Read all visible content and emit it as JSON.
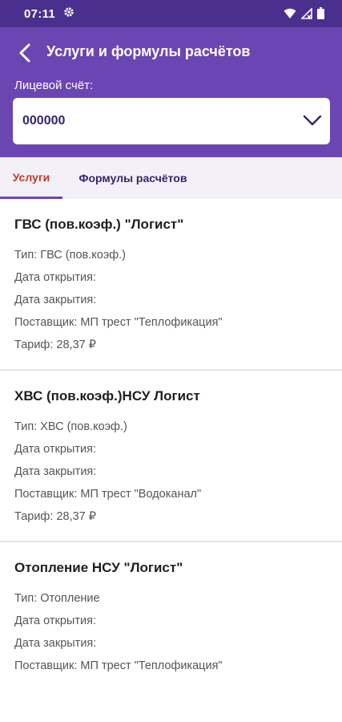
{
  "status_bar": {
    "time": "07:11",
    "gear_icon": "gear-icon",
    "icons": [
      "wifi-icon",
      "signal-icon",
      "battery-icon"
    ]
  },
  "colors": {
    "header": "#6b46b3",
    "status_bar": "#4a2f8f",
    "active_tab_text": "#c0392b",
    "inactive_tab_text": "#35236e"
  },
  "header": {
    "title": "Услуги и формулы расчётов",
    "back_icon": "chevron-left-icon"
  },
  "account": {
    "label": "Лицевой счёт:",
    "value": "000000",
    "chevron_icon": "chevron-down-icon"
  },
  "tabs": [
    {
      "label": "Услуги",
      "active": true
    },
    {
      "label": "Формулы расчётов",
      "active": false
    }
  ],
  "services": [
    {
      "title": "ГВС (пов.коэф.) \"Логист\"",
      "type": "Тип: ГВС (пов.коэф.)",
      "opened": "Дата открытия:",
      "closed": "Дата закрытия:",
      "supplier": "Поставщик: МП трест \"Теплофикация\"",
      "tariff": "Тариф: 28,37 ₽"
    },
    {
      "title": "ХВС (пов.коэф.)НСУ Логист",
      "type": "Тип: ХВС (пов.коэф.)",
      "opened": "Дата открытия:",
      "closed": "Дата закрытия:",
      "supplier": "Поставщик: МП трест \"Водоканал\"",
      "tariff": "Тариф: 28,37 ₽"
    },
    {
      "title": "Отопление НСУ \"Логист\"",
      "type": "Тип: Отопление",
      "opened": "Дата открытия:",
      "closed": "Дата закрытия:",
      "supplier": "Поставщик: МП трест \"Теплофикация\""
    }
  ]
}
